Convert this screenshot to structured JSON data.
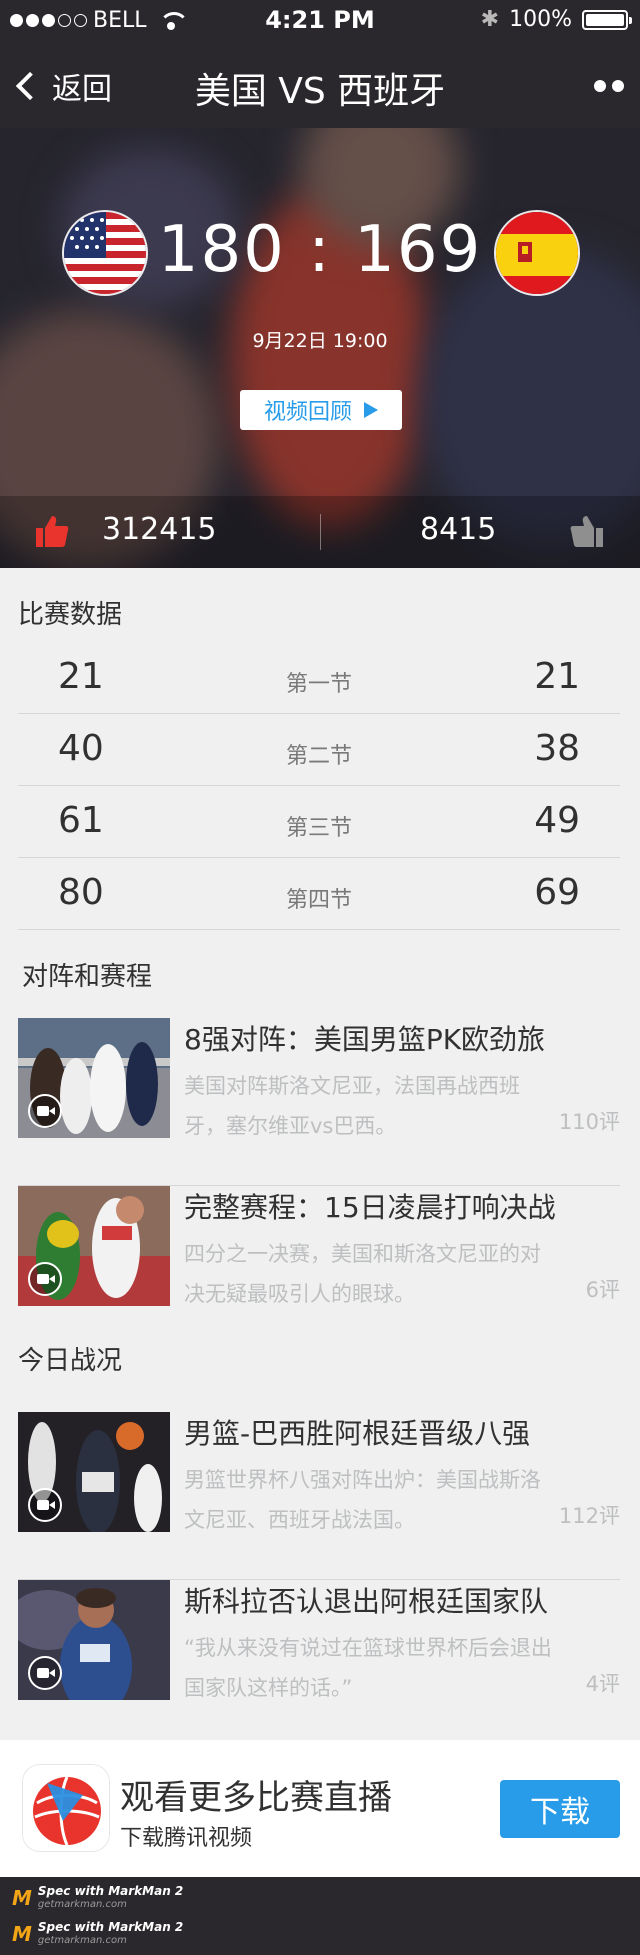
{
  "status_bar": {
    "carrier": "BELL",
    "time": "4:21 PM",
    "battery": "100%",
    "battery_level": 1.0
  },
  "nav": {
    "back_label": "返回",
    "title": "美国 VS 西班牙"
  },
  "match": {
    "score": "180 : 169",
    "datetime": "9月22日  19:00",
    "replay_label": "视频回顾",
    "votes_left": "312415",
    "votes_right": "8415"
  },
  "stats": {
    "title": "比赛数据",
    "rows": [
      {
        "left": "21",
        "label": "第一节",
        "right": "21"
      },
      {
        "left": "40",
        "label": "第二节",
        "right": "38"
      },
      {
        "left": "61",
        "label": "第三节",
        "right": "49"
      },
      {
        "left": "80",
        "label": "第四节",
        "right": "69"
      }
    ]
  },
  "schedule": {
    "title": "对阵和赛程",
    "items": [
      {
        "title": "8强对阵：美国男篮PK欧劲旅",
        "desc": "美国对阵斯洛文尼亚，法国再战西班牙，塞尔维亚vs巴西。",
        "count": "110评"
      },
      {
        "title": "完整赛程：15日凌晨打响决战",
        "desc": "四分之一决赛，美国和斯洛文尼亚的对决无疑最吸引人的眼球。",
        "count": "6评"
      }
    ]
  },
  "today": {
    "title": "今日战况",
    "items": [
      {
        "title": "男篮-巴西胜阿根廷晋级八强",
        "desc": "男篮世界杯八强对阵出炉：美国战斯洛文尼亚、西班牙战法国。",
        "count": "112评"
      },
      {
        "title": "斯科拉否认退出阿根廷国家队",
        "desc": "“我从来没有说过在篮球世界杯后会退出国家队这样的话。”",
        "count": "4评"
      }
    ]
  },
  "download": {
    "title": "观看更多比赛直播",
    "subtitle": "下载腾讯视频",
    "button": "下载"
  },
  "footer": {
    "brand": "Spec with MarkMan 2",
    "url": "getmarkman.com"
  },
  "colors": {
    "nav_bg": "#2a282c",
    "accent": "#289ce9",
    "text": "#313131",
    "secondary": "#797979",
    "light_text": "#bdbfc0",
    "divider": "#d7d7d7",
    "bg": "#f0f0f0",
    "thumb_red": "#e8342c"
  }
}
